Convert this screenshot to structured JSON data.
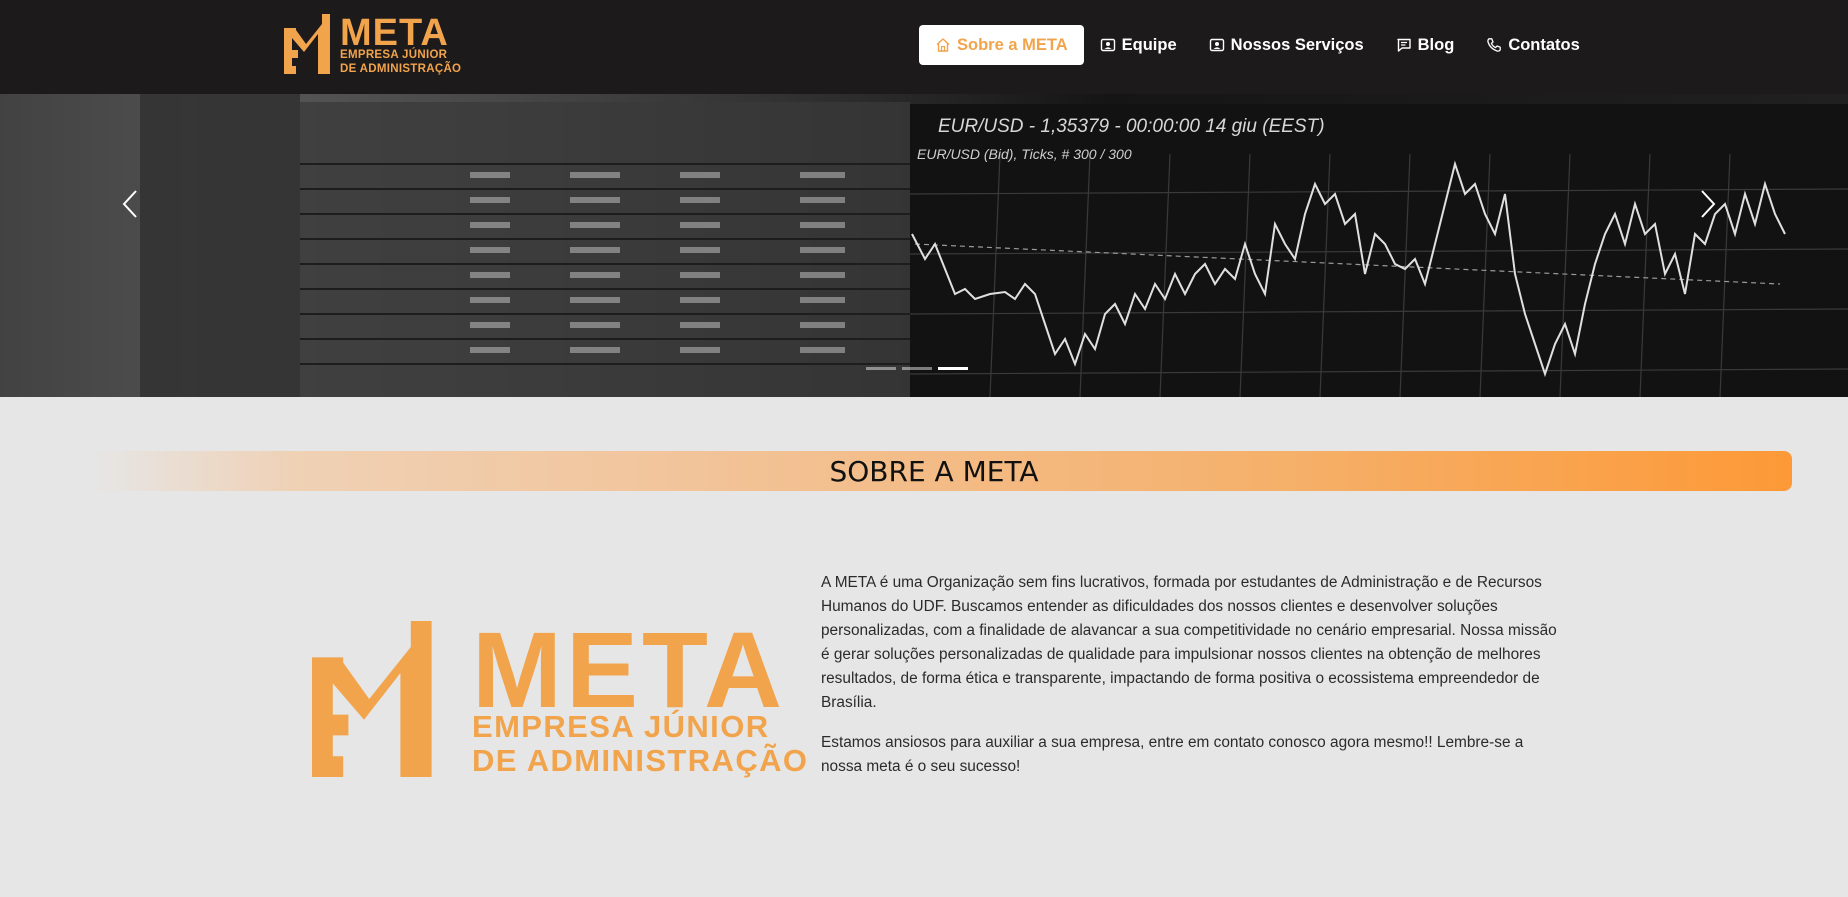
{
  "brand": {
    "name": "META",
    "line1": "EMPRESA JÚNIOR",
    "line2": "DE ADMINISTRAÇÃO"
  },
  "nav": [
    {
      "label": "Sobre a META",
      "icon": "home-icon",
      "active": true
    },
    {
      "label": "Equipe",
      "icon": "person-badge-icon",
      "active": false
    },
    {
      "label": "Nossos Serviços",
      "icon": "person-badge-icon",
      "active": false
    },
    {
      "label": "Blog",
      "icon": "chat-icon",
      "active": false
    },
    {
      "label": "Contatos",
      "icon": "phone-icon",
      "active": false
    }
  ],
  "carousel": {
    "chart_title": "EUR/USD - 1,35379 - 00:00:00  14 giu (EEST)",
    "chart_sub": "EUR/USD (Bid), Ticks, # 300 / 300",
    "slides": 3,
    "active_slide": 3,
    "prev_icon": "chevron-left-icon",
    "next_icon": "chevron-right-icon"
  },
  "section": {
    "title": "SOBRE A META"
  },
  "about": {
    "logo_name": "META",
    "logo_line1": "EMPRESA JÚNIOR",
    "logo_line2": "DE ADMINISTRAÇÃO",
    "paragraph1": "A META é uma Organização sem fins lucrativos, formada por estudantes de Administração e de Recursos Humanos do UDF. Buscamos entender as dificuldades dos nossos clientes e desenvolver soluções personalizadas, com a finalidade de alavancar a sua competitividade no cenário empresarial. Nossa missão é gerar soluções personalizadas de qualidade para impulsionar nossos clientes na obtenção de melhores resultados, de forma ética e transparente, impactando de forma positiva o ecossistema empreendedor de Brasília.",
    "paragraph2": "Estamos ansiosos para auxiliar a sua empresa, entre em contato conosco agora mesmo!! Lembre-se a nossa meta é o seu sucesso!"
  },
  "colors": {
    "brand_orange": "#f1a44c",
    "navbar_bg": "#1c1a1b",
    "page_bg": "#e6e6e6"
  }
}
